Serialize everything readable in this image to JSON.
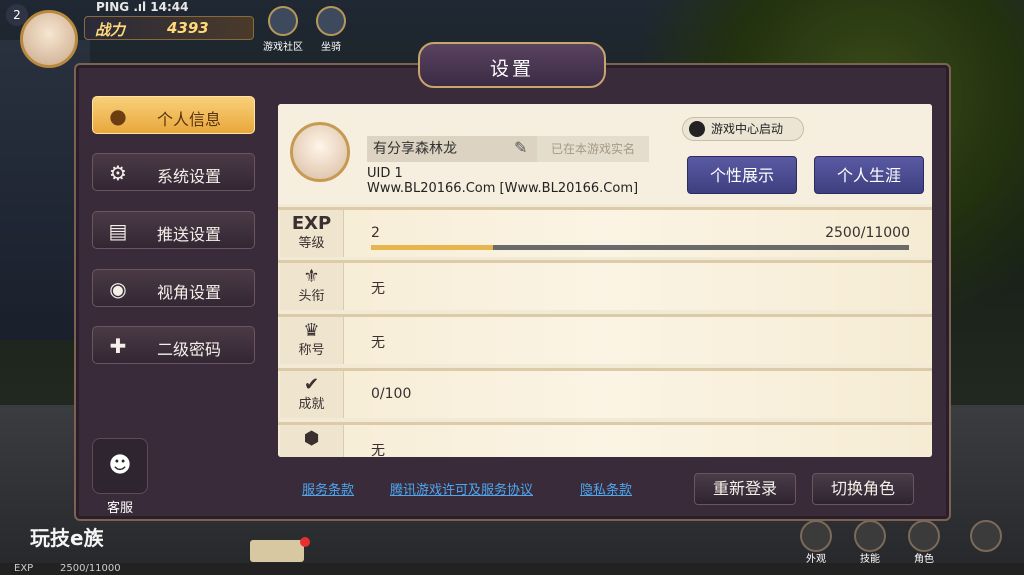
{
  "hud": {
    "level": "2",
    "ping": "PING .ıl 14:44",
    "power_label": "战力",
    "power_value": "4393",
    "btn_community": "游戏社区",
    "btn_mount": "坐骑"
  },
  "panel": {
    "title": "设置"
  },
  "nav": {
    "items": [
      {
        "label": "个人信息",
        "icon": "user-badge-icon"
      },
      {
        "label": "系统设置",
        "icon": "gear-icon"
      },
      {
        "label": "推送设置",
        "icon": "message-icon"
      },
      {
        "label": "视角设置",
        "icon": "eye-icon"
      },
      {
        "label": "二级密码",
        "icon": "shield-cross-icon"
      }
    ],
    "service_label": "客服"
  },
  "profile": {
    "name": "有分享森林龙",
    "verified": "已在本游戏实名",
    "uid": "UID 1",
    "url": "Www.BL20166.Com [Www.BL20166.Com]",
    "qq_launch": "游戏中心启动",
    "btn_showcase": "个性展示",
    "btn_career": "个人生涯"
  },
  "stats": {
    "exp_symbol": "EXP",
    "exp_label": "等级",
    "exp_level": "2",
    "exp_progress": "2500/11000",
    "exp_fraction": 0.227,
    "title_label": "头衔",
    "title_value": "无",
    "name_label": "称号",
    "name_value": "无",
    "achv_label": "成就",
    "achv_value": "0/100",
    "last_value": "无"
  },
  "footer": {
    "terms": "服务条款",
    "license": "腾讯游戏许可及服务协议",
    "privacy": "隐私条款",
    "relogin": "重新登录",
    "switch_role": "切换角色"
  },
  "bottom": {
    "watermark": "玩技e族",
    "exp_label": "EXP",
    "exp_value": "2500/11000",
    "btn_outfit": "外观",
    "btn_skill": "技能",
    "btn_role": "角色"
  },
  "colors": {
    "accent": "#e9a73c",
    "panel_bg": "#3a2b3a",
    "content_bg": "#f3ead6",
    "primary_button": "#4a4a92",
    "link": "#4da7f0"
  }
}
